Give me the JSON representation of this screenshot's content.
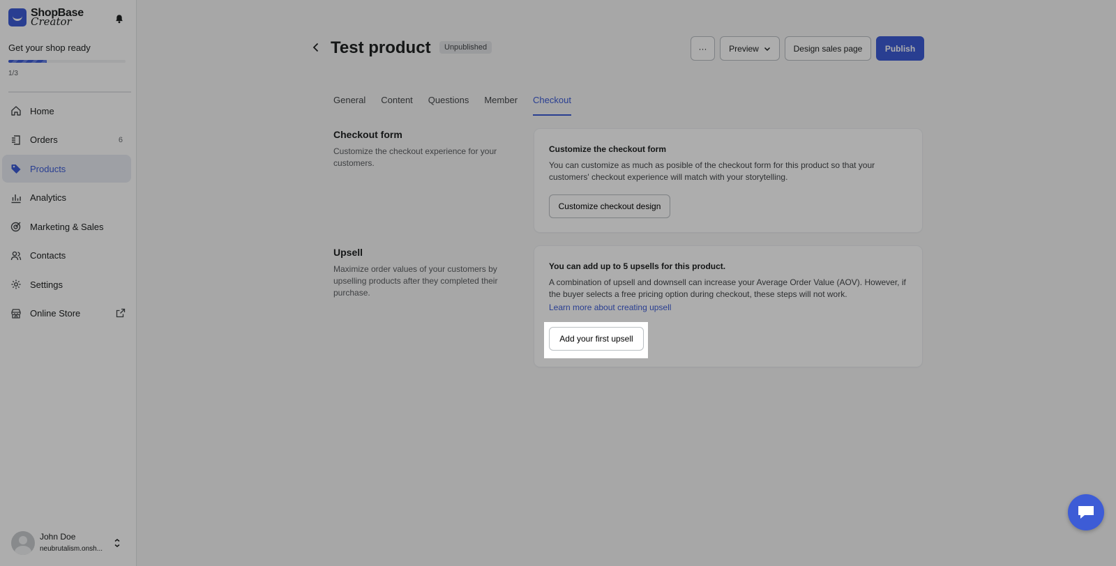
{
  "app": {
    "logo_line1": "ShopBase",
    "logo_line2": "Creator"
  },
  "onboarding": {
    "title": "Get your shop ready",
    "progress_fraction": 0.33,
    "count": "1/3"
  },
  "sidebar": {
    "items": [
      {
        "label": "Home",
        "icon": "home-icon",
        "active": false
      },
      {
        "label": "Orders",
        "icon": "orders-icon",
        "badge": "6",
        "active": false
      },
      {
        "label": "Products",
        "icon": "tag-icon",
        "active": true
      },
      {
        "label": "Analytics",
        "icon": "analytics-icon",
        "active": false
      },
      {
        "label": "Marketing & Sales",
        "icon": "target-icon",
        "active": false
      },
      {
        "label": "Contacts",
        "icon": "contacts-icon",
        "active": false
      },
      {
        "label": "Settings",
        "icon": "gear-icon",
        "active": false
      },
      {
        "label": "Online Store",
        "icon": "store-icon",
        "active": false
      }
    ]
  },
  "user": {
    "name": "John Doe",
    "store": "neubrutalism.onsh..."
  },
  "header": {
    "title": "Test product",
    "status": "Unpublished",
    "more_label": "···",
    "preview_label": "Preview",
    "design_label": "Design sales page",
    "publish_label": "Publish"
  },
  "tabs": [
    {
      "label": "General",
      "active": false
    },
    {
      "label": "Content",
      "active": false
    },
    {
      "label": "Questions",
      "active": false
    },
    {
      "label": "Member",
      "active": false
    },
    {
      "label": "Checkout",
      "active": true
    }
  ],
  "checkout_form": {
    "section_title": "Checkout form",
    "section_desc": "Customize the checkout experience for your customers.",
    "card_title": "Customize the checkout form",
    "card_text": "You can customize as much as posible of the checkout form for this product so that your customers' checkout experience will match with your storytelling.",
    "button_label": "Customize checkout design"
  },
  "upsell": {
    "section_title": "Upsell",
    "section_desc": "Maximize order values of your customers by upselling products after they completed their purchase.",
    "card_title": "You can add up to 5 upsells for this product.",
    "card_text": "A combination of upsell and downsell can increase your Average Order Value (AOV). However, if the buyer selects a free pricing option during checkout, these steps will not work.",
    "link_label": "Learn more about creating upsell",
    "button_label": "Add your first upsell"
  },
  "colors": {
    "accent": "#3d5cd6",
    "background": "#f6f6f7"
  }
}
